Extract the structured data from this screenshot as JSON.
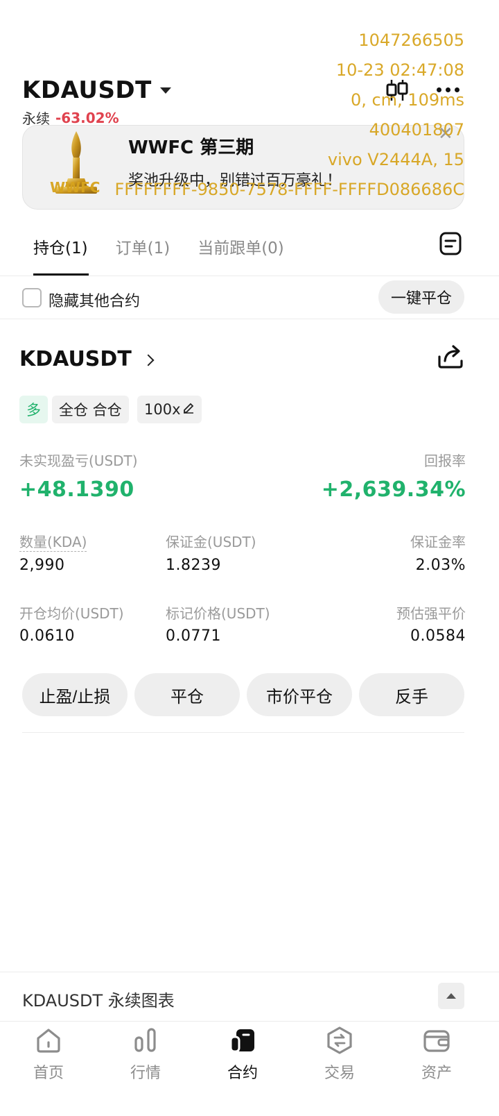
{
  "header": {
    "symbol": "KDAUSDT",
    "contract_type": "永续",
    "change": "-63.02%"
  },
  "watermark": {
    "line1": "1047266505",
    "line2": "10-23 02:47:08",
    "line3": "0, cm, 109ms",
    "line4": "400401807",
    "line5": "vivo V2444A, 15",
    "line6": "FFFFFFFF-9850-7578-FFFF-FFFFD086686C"
  },
  "banner": {
    "title": "WWFC 第三期",
    "subtitle": "奖池升级中，别错过百万豪礼！",
    "logo_text": "WWFC"
  },
  "tabs": [
    {
      "label": "持仓(1)",
      "active": true
    },
    {
      "label": "订单(1)",
      "active": false
    },
    {
      "label": "当前跟单(0)",
      "active": false
    }
  ],
  "filter": {
    "hide_others_label": "隐藏其他合约",
    "close_all_label": "一键平仓"
  },
  "position": {
    "symbol": "KDAUSDT",
    "side_tag": "多",
    "margin_tag": "全仓 合仓",
    "leverage_tag": "100x",
    "unrealized_pnl_label": "未实现盈亏(USDT)",
    "unrealized_pnl_value": "+48.1390",
    "roe_label": "回报率",
    "roe_value": "+2,639.34%",
    "qty_label": "数量(KDA)",
    "qty_value": "2,990",
    "margin_label": "保证金(USDT)",
    "margin_value": "1.8239",
    "margin_rate_label": "保证金率",
    "margin_rate_value": "2.03%",
    "entry_label": "开仓均价(USDT)",
    "entry_value": "0.0610",
    "mark_label": "标记价格(USDT)",
    "mark_value": "0.0771",
    "liq_label": "预估强平价",
    "liq_value": "0.0584"
  },
  "actions": {
    "tp_sl": "止盈/止损",
    "close": "平仓",
    "market_close": "市价平仓",
    "reverse": "反手"
  },
  "chart_bar": {
    "label": "KDAUSDT 永续图表"
  },
  "bottom_nav": [
    {
      "label": "首页",
      "icon": "home-icon",
      "active": false
    },
    {
      "label": "行情",
      "icon": "market-icon",
      "active": false
    },
    {
      "label": "合约",
      "icon": "futures-icon",
      "active": true
    },
    {
      "label": "交易",
      "icon": "trade-icon",
      "active": false
    },
    {
      "label": "资产",
      "icon": "wallet-icon",
      "active": false
    }
  ],
  "colors": {
    "green": "#20b26c",
    "red": "#e0424e",
    "watermark": "#d7a41d"
  }
}
